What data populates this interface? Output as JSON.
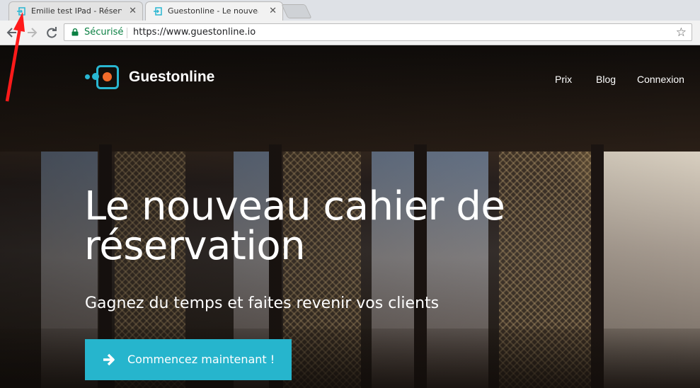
{
  "browser": {
    "tabs": [
      {
        "title": "Emilie test IPad - Réserva",
        "close": "✕"
      },
      {
        "title": "Guestonline - Le nouveau",
        "close": "✕"
      }
    ],
    "secure_label": "Sécurisé",
    "url": "https://www.guestonline.io",
    "icons": [
      "back-icon",
      "forward-icon",
      "reload-icon",
      "lock-icon",
      "star-icon",
      "tab-favicon"
    ]
  },
  "site": {
    "brand": "Guestonline",
    "nav": [
      "Prix",
      "Blog",
      "Connexion"
    ],
    "hero_title": "Le nouveau cahier de réservation",
    "hero_subtitle": "Gagnez du temps et faites revenir vos clients",
    "cta_label": "Commencez maintenant !"
  },
  "colors": {
    "accent": "#26b5cd",
    "logo_orange": "#f26b2a",
    "secure_green": "#0b8043",
    "annotation_red": "#ff1a1a"
  }
}
